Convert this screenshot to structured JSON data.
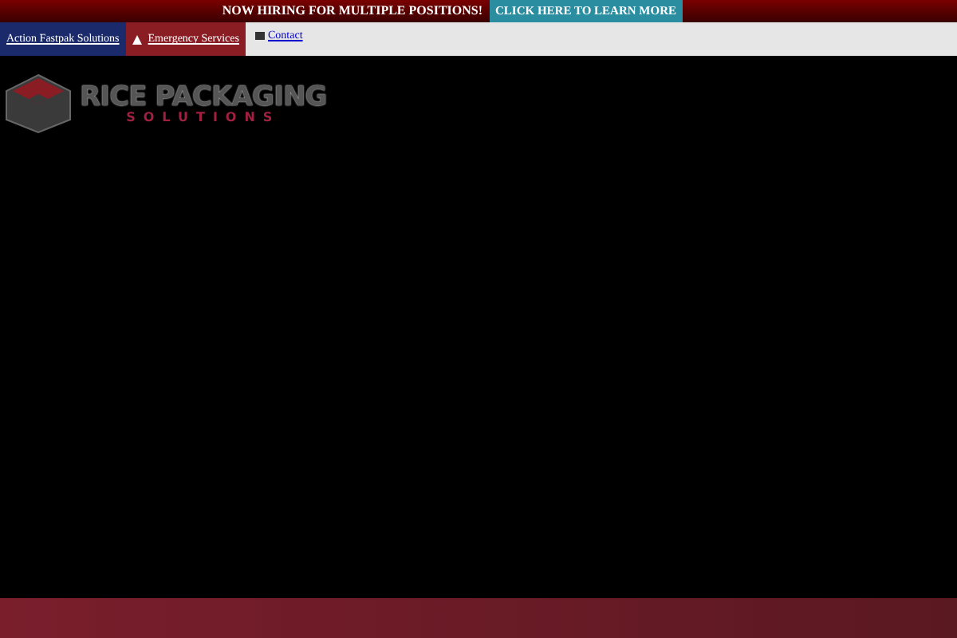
{
  "announcement": {
    "text": "NOW HIRING FOR MULTIPLE POSITIONS!",
    "button": "CLICK HERE TO LEARN MORE"
  },
  "top_links": [
    {
      "label": "Contact"
    }
  ],
  "tabs": [
    {
      "label": "Action Fastpak Solutions",
      "selected": false
    },
    {
      "label": "Emergency Services",
      "selected": true
    }
  ],
  "logo": {
    "title": "RICE PACKAGING",
    "subtitle": "SOLUTIONS"
  }
}
